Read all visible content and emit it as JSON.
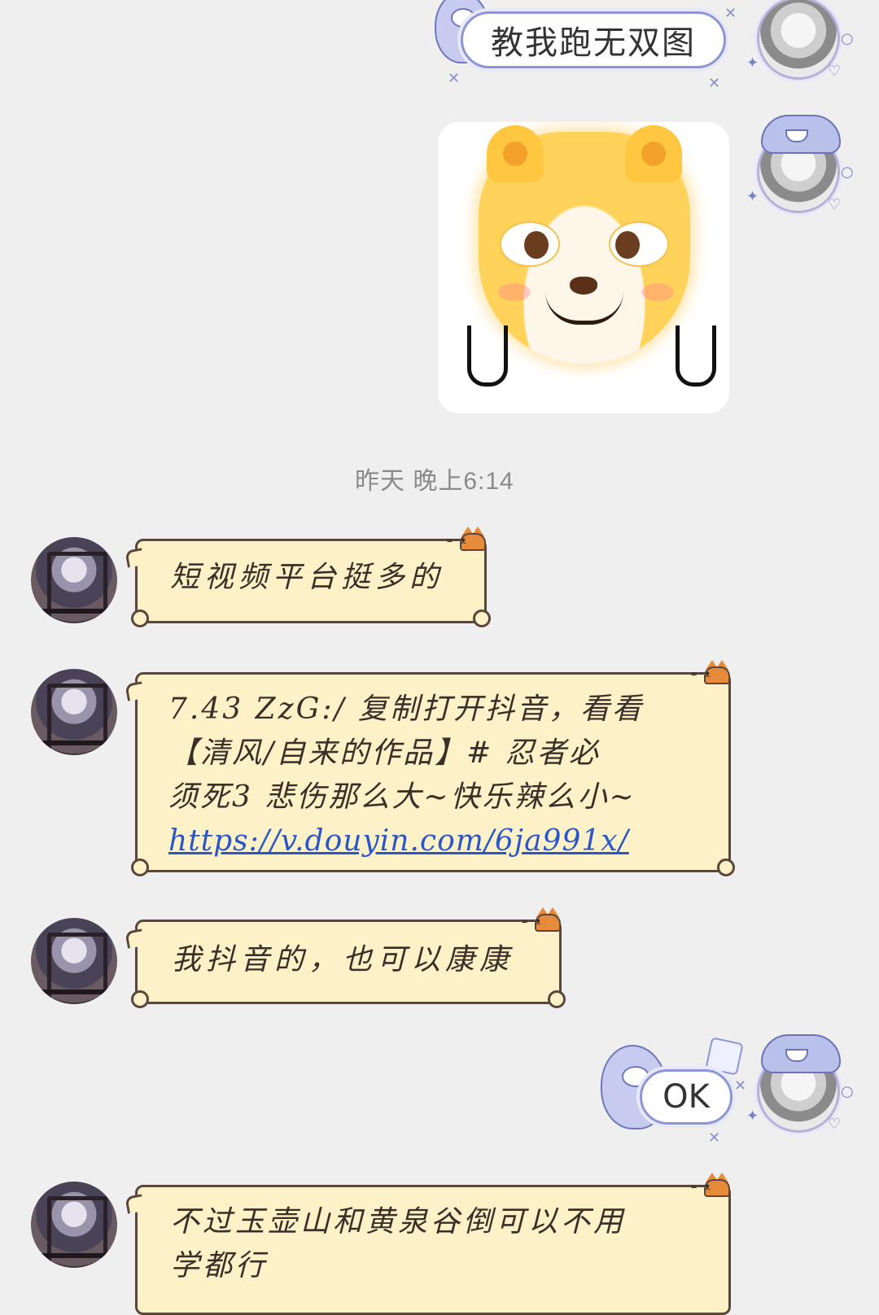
{
  "timestamp": "昨天 晚上6:14",
  "messages": {
    "m1": {
      "text": "教我跑无双图"
    },
    "m2": {
      "sticker_name": "shiba-sticker"
    },
    "m3": {
      "text": "短视频平台挺多的"
    },
    "m4": {
      "line1": "7.43 ZzG:/ 复制打开抖音，看看",
      "line2": "【清风/自来的作品】# 忍者必",
      "line3": "须死3 悲伤那么大~快乐辣么小~",
      "link": "https://v.douyin.com/6ja991x/"
    },
    "m5": {
      "text": "我抖音的，也可以康康"
    },
    "m6": {
      "text": "OK"
    },
    "m7": {
      "line1": "不过玉壶山和黄泉谷倒可以不用",
      "line2": "学都行"
    }
  },
  "colors": {
    "background": "#efefef",
    "right_bubble_border": "#8e95d4",
    "left_bubble_fill": "#fdf1c7",
    "link": "#2a56c9"
  }
}
